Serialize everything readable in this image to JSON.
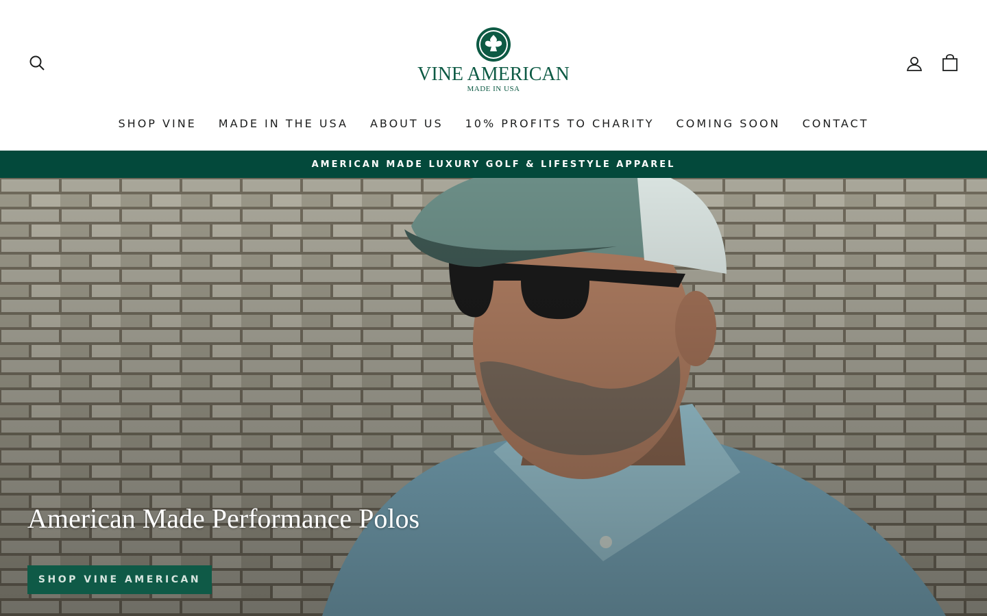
{
  "brand": {
    "name": "VINE AMERICAN",
    "tagline": "MADE IN USA",
    "color": "#0d5a44"
  },
  "header": {
    "icons": {
      "search": "search-icon",
      "account": "user-icon",
      "cart": "shopping-bag-icon"
    }
  },
  "nav": {
    "items": [
      {
        "label": "SHOP VINE"
      },
      {
        "label": "MADE IN THE USA"
      },
      {
        "label": "ABOUT US"
      },
      {
        "label": "10% PROFITS TO CHARITY"
      },
      {
        "label": "COMING SOON"
      },
      {
        "label": "CONTACT"
      }
    ]
  },
  "announcement": {
    "text": "AMERICAN MADE LUXURY GOLF & LIFESTYLE APPAREL",
    "background": "#03493b"
  },
  "hero": {
    "title": "American Made Performance Polos",
    "cta_label": "SHOP VINE AMERICAN",
    "cta_color": "#0f5a47"
  }
}
